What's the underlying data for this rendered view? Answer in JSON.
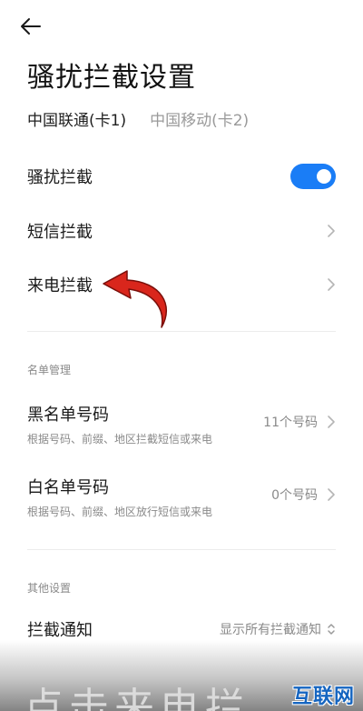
{
  "page": {
    "title": "骚扰拦截设置"
  },
  "sim_tabs": [
    {
      "label": "中国联通(卡1)",
      "active": true
    },
    {
      "label": "中国移动(卡2)",
      "active": false
    }
  ],
  "settings": {
    "harass_block": {
      "label": "骚扰拦截",
      "toggle_on": true
    },
    "sms_block": {
      "label": "短信拦截"
    },
    "call_block": {
      "label": "来电拦截"
    }
  },
  "list_management": {
    "header": "名单管理",
    "blacklist": {
      "label": "黑名单号码",
      "description": "根据号码、前缀、地区拦截短信或来电",
      "value": "11个号码"
    },
    "whitelist": {
      "label": "白名单号码",
      "description": "根据号码、前缀、地区放行短信或来电",
      "value": "0个号码"
    }
  },
  "other_settings": {
    "header": "其他设置",
    "block_notification": {
      "label": "拦截通知",
      "value": "显示所有拦截通知"
    }
  },
  "overlay": {
    "caption": "点击来电拦",
    "watermark": "互联网"
  },
  "colors": {
    "accent": "#1a7df6",
    "arrow": "#d9261c",
    "watermark": "#1565c0"
  },
  "icons": [
    "back-arrow-icon",
    "chevron-right-icon",
    "up-down-chevron-icon",
    "red-curved-arrow"
  ]
}
